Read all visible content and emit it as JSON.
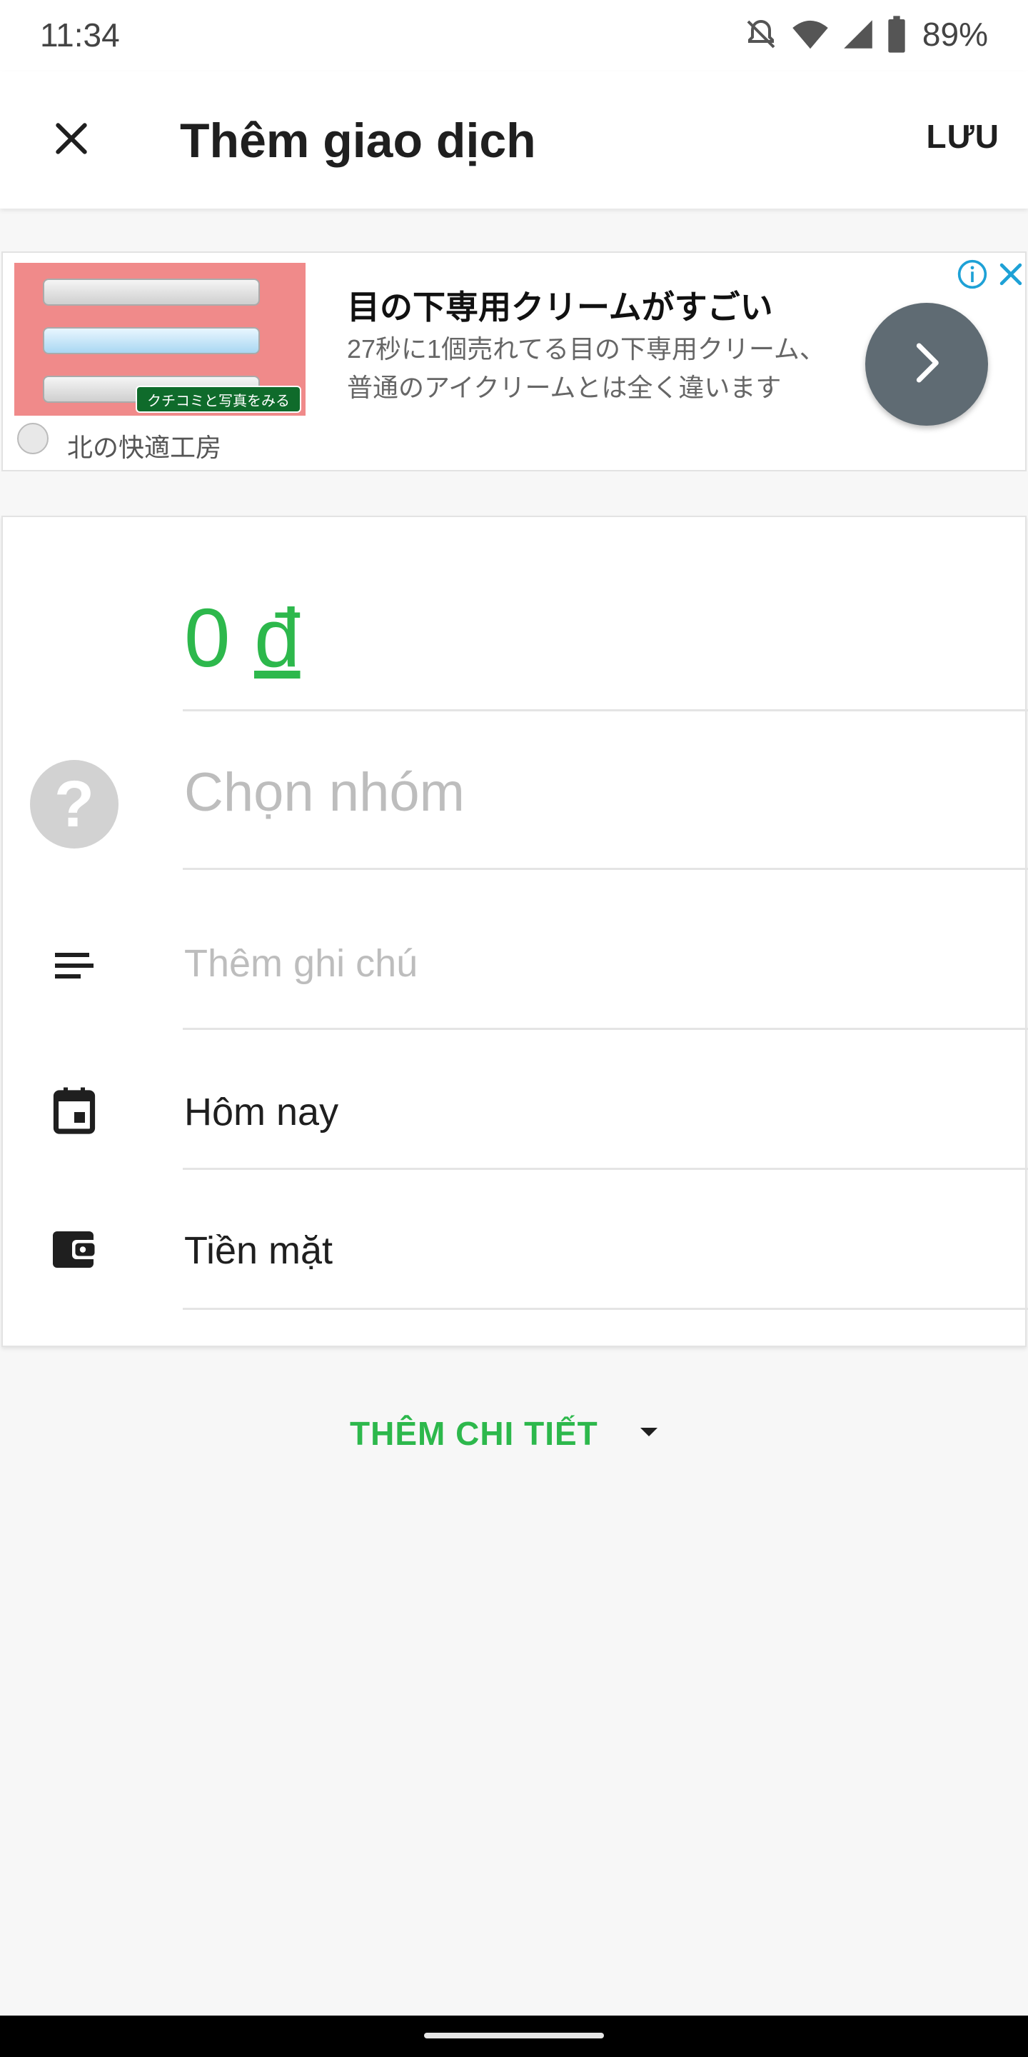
{
  "status_bar": {
    "time": "11:34",
    "battery": "89%",
    "icons": [
      "bell-off-icon",
      "wifi-icon",
      "signal-icon",
      "battery-icon"
    ]
  },
  "app_bar": {
    "title": "Thêm giao dịch",
    "save_label": "LƯU",
    "close_icon": "close-icon"
  },
  "ad": {
    "headline": "目の下専用クリームがすごい",
    "body": "27秒に1個売れてる目の下専用クリーム、普通のアイクリームとは全く違います",
    "brand": "北の快適工房",
    "badge": "クチコミと写真をみる"
  },
  "form": {
    "amount_value": "0",
    "currency": "đ",
    "group_placeholder": "Chọn nhóm",
    "note_placeholder": "Thêm ghi chú",
    "date_value": "Hôm nay",
    "wallet_value": "Tiền mặt"
  },
  "more_details": {
    "label": "THÊM CHI TIẾT"
  },
  "colors": {
    "accent": "#2db84c",
    "placeholder": "#bdbdbd",
    "ad_cta": "#5f6b73"
  }
}
